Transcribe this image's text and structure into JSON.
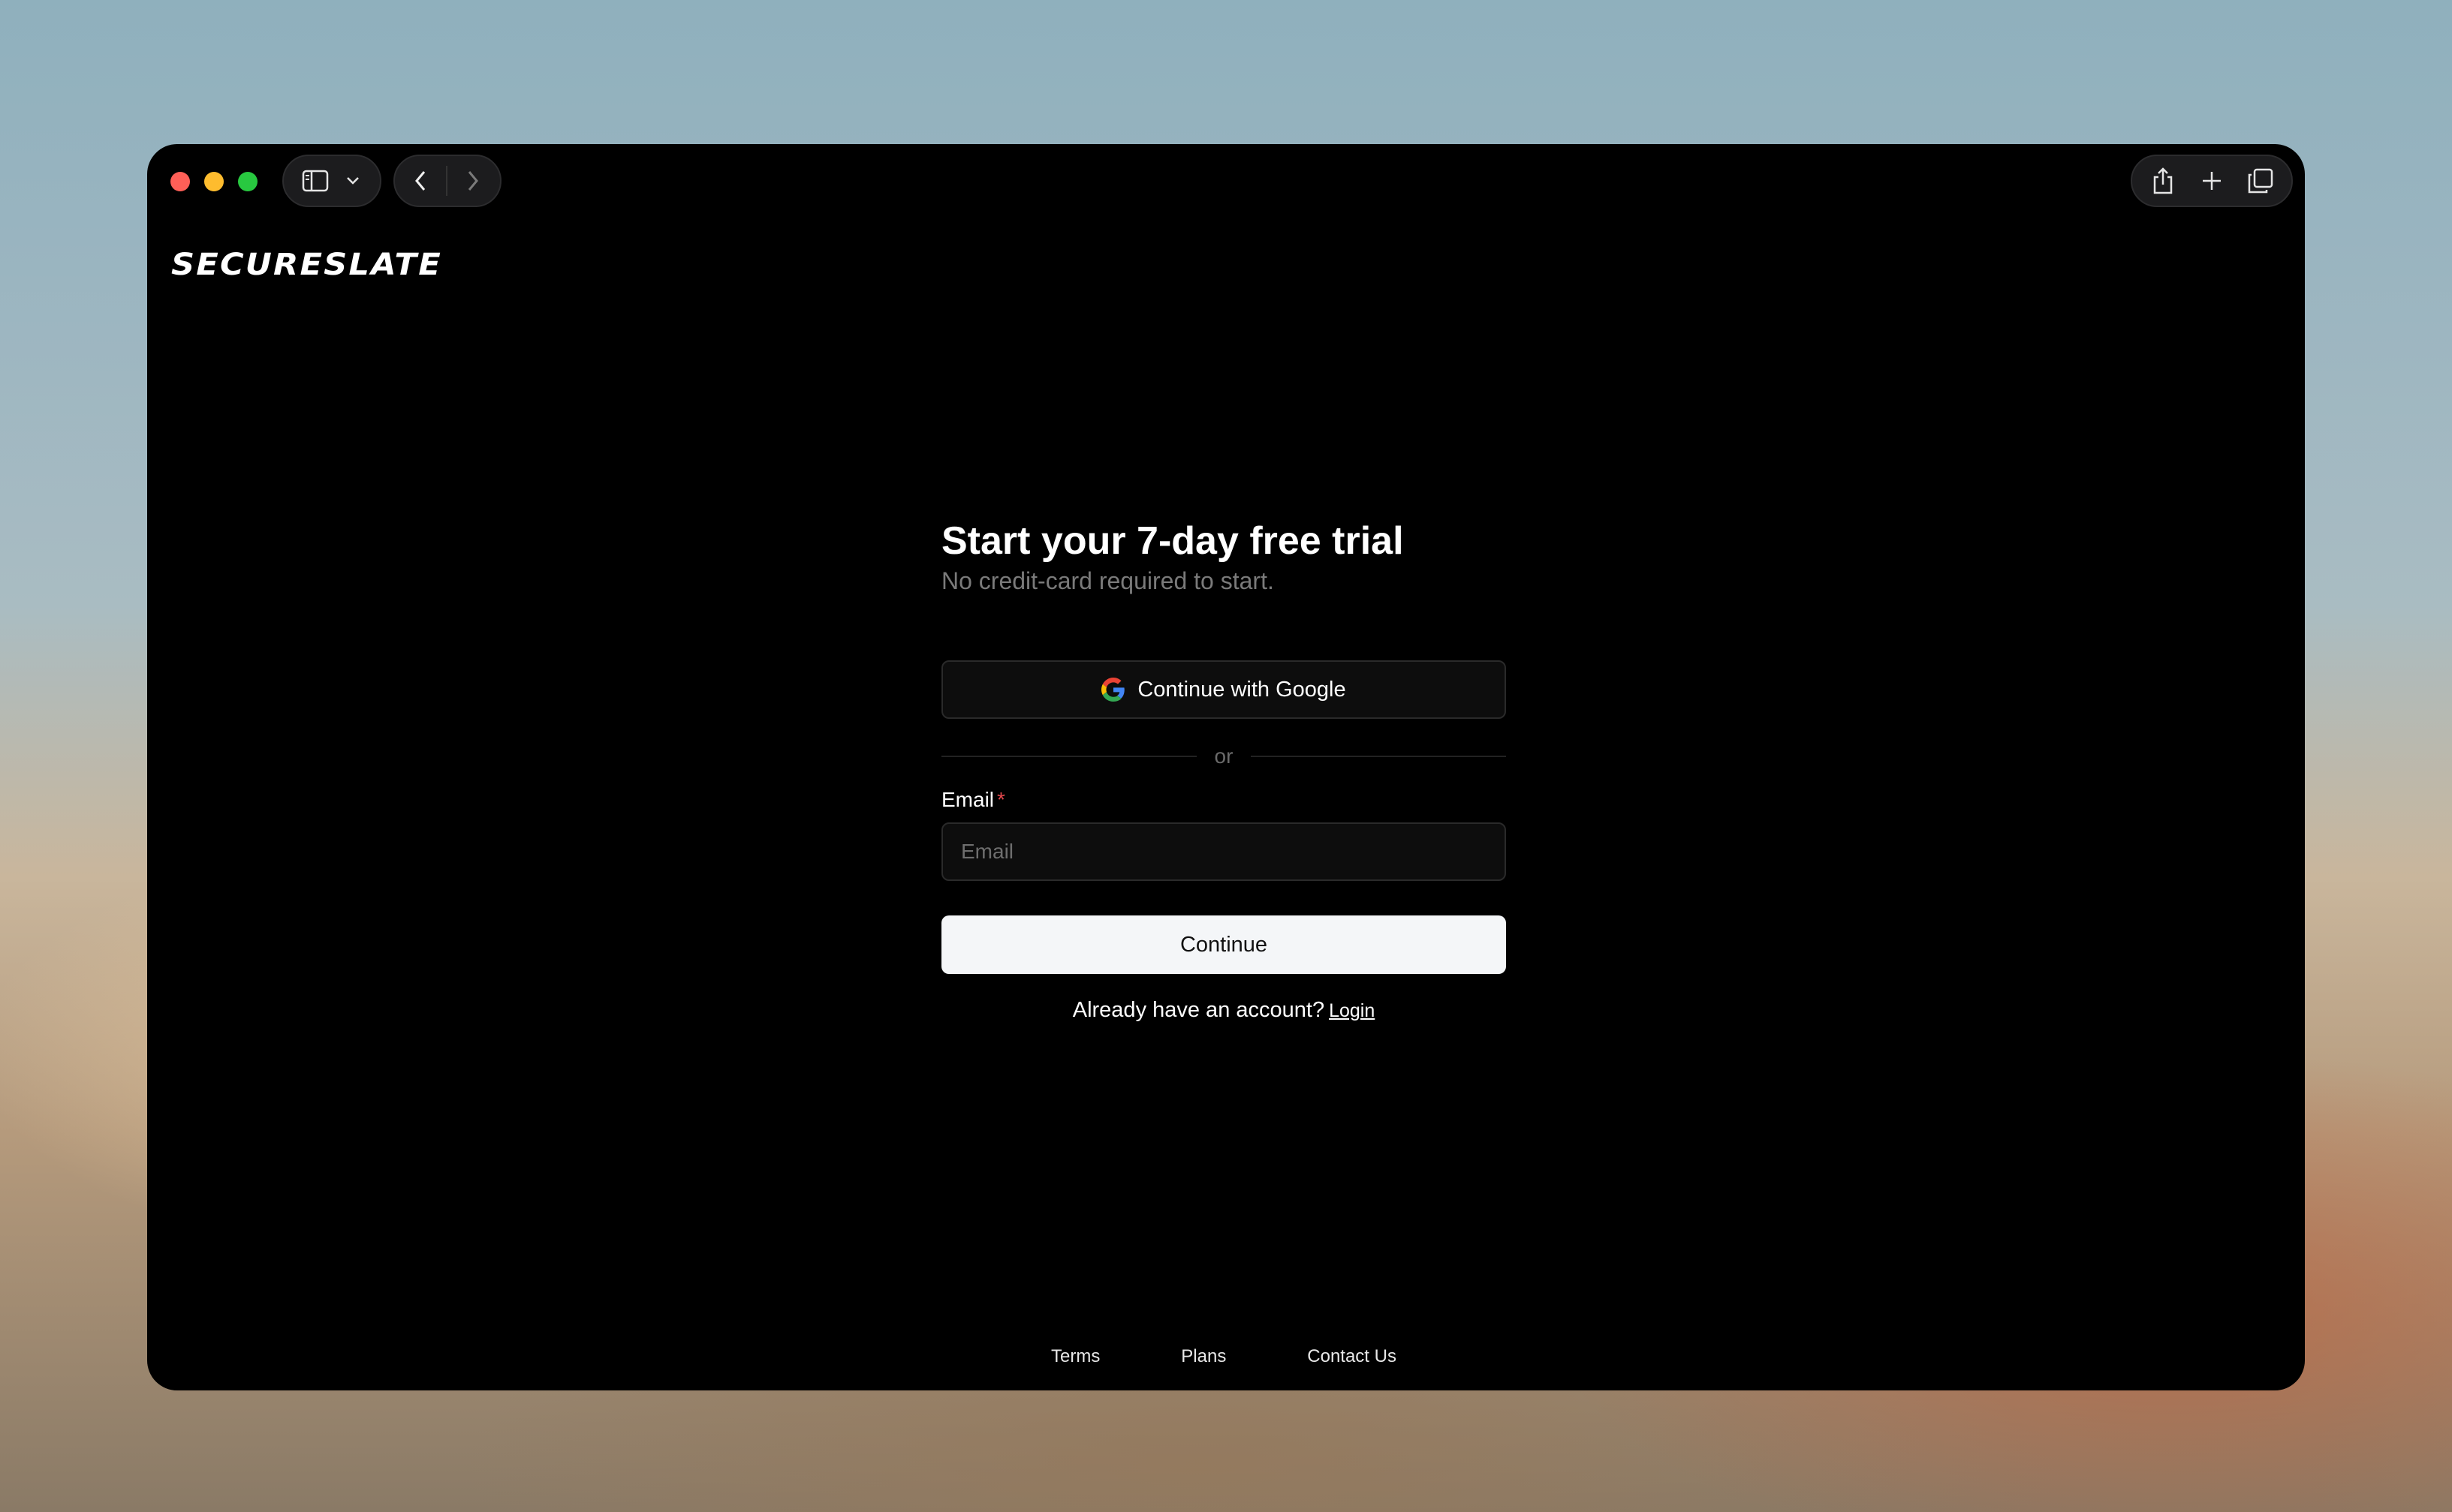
{
  "browser": {
    "icons": {
      "sidebar": "sidebar-icon",
      "chevron": "chevron-down-icon",
      "back": "back-arrow-icon",
      "forward": "forward-arrow-icon",
      "share": "share-icon",
      "new_tab": "plus-icon",
      "tabs": "tabs-overview-icon"
    },
    "colors": {
      "red": "#fe5f57",
      "yellow": "#febc2e",
      "green": "#28c840"
    }
  },
  "brand": {
    "logo": "SECURESLATE"
  },
  "signup": {
    "title": "Start your 7-day free trial",
    "subtitle": "No credit-card required to start.",
    "google_button": "Continue with Google",
    "divider": "or",
    "email_label": "Email",
    "email_required": "*",
    "email_placeholder": "Email",
    "email_value": "",
    "continue_button": "Continue",
    "login_prompt": "Already have an account?",
    "login_link": "Login"
  },
  "footer": {
    "links": [
      "Terms",
      "Plans",
      "Contact Us"
    ]
  }
}
